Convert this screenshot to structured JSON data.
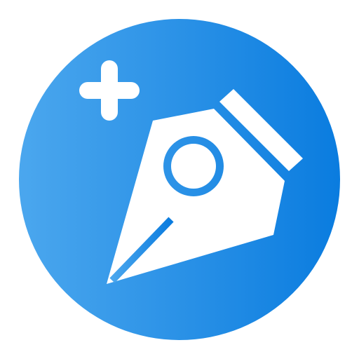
{
  "icon": {
    "name": "pen-tool-add-icon",
    "gradient": {
      "start": "#4BA7EE",
      "end": "#0A7CDF"
    },
    "glyph_color": "#FFFFFF",
    "parts": [
      "plus-icon",
      "pen-nib-icon"
    ]
  }
}
